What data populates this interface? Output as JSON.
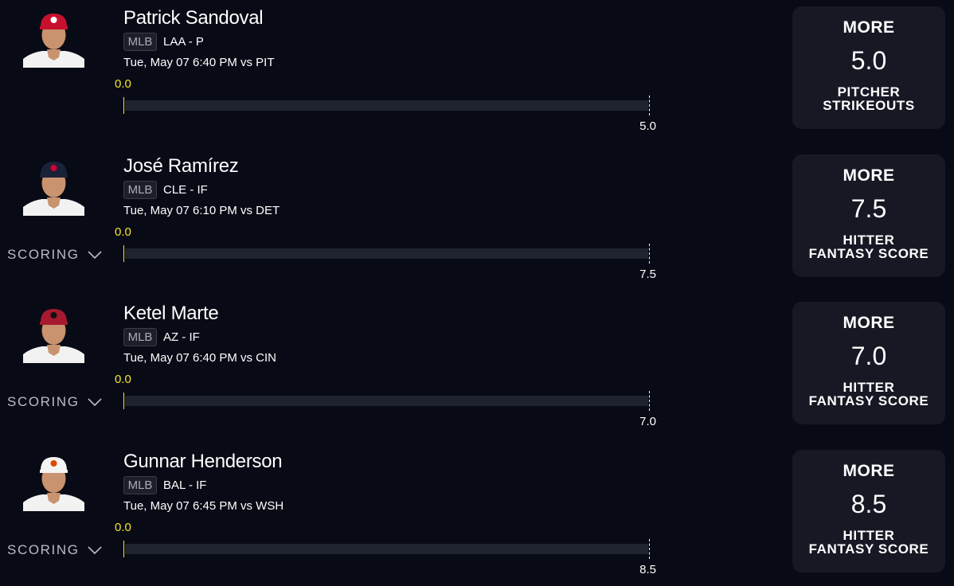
{
  "picks": [
    {
      "player": "Patrick Sandoval",
      "league": "MLB",
      "team_position": "LAA - P",
      "game": "Tue, May 07 6:40 PM  vs PIT",
      "current": "0.0",
      "progress": 0,
      "line": "5.0",
      "direction": "MORE",
      "stat_line1": "PITCHER",
      "stat_line2": "STRIKEOUTS",
      "scoring": null,
      "cap_color": "#c8102e",
      "logo_color": "#ffffff"
    },
    {
      "player": "José Ramírez",
      "league": "MLB",
      "team_position": "CLE - IF",
      "game": "Tue, May 07 6:10 PM  vs DET",
      "current": "0.0",
      "progress": 0,
      "line": "7.5",
      "direction": "MORE",
      "stat_line1": "HITTER",
      "stat_line2": "FANTASY SCORE",
      "scoring": "SCORING",
      "cap_color": "#1a2238",
      "logo_color": "#d50032"
    },
    {
      "player": "Ketel Marte",
      "league": "MLB",
      "team_position": "AZ - IF",
      "game": "Tue, May 07 6:40 PM  vs CIN",
      "current": "0.0",
      "progress": 0,
      "line": "7.0",
      "direction": "MORE",
      "stat_line1": "HITTER",
      "stat_line2": "FANTASY SCORE",
      "scoring": "SCORING",
      "cap_color": "#a71930",
      "logo_color": "#111111"
    },
    {
      "player": "Gunnar Henderson",
      "league": "MLB",
      "team_position": "BAL - IF",
      "game": "Tue, May 07 6:45 PM  vs WSH",
      "current": "0.0",
      "progress": 0,
      "line": "8.5",
      "direction": "MORE",
      "stat_line1": "HITTER",
      "stat_line2": "FANTASY SCORE",
      "scoring": "SCORING",
      "cap_color": "#f4f4f4",
      "logo_color": "#df4601"
    }
  ],
  "colors": {
    "background": "#080a15",
    "accent_yellow": "#f5e62a",
    "card": "#161924",
    "track": "#1f2330"
  },
  "icons": {
    "avatar": "player-headshot-icon",
    "chevron": "chevron-down-icon"
  }
}
